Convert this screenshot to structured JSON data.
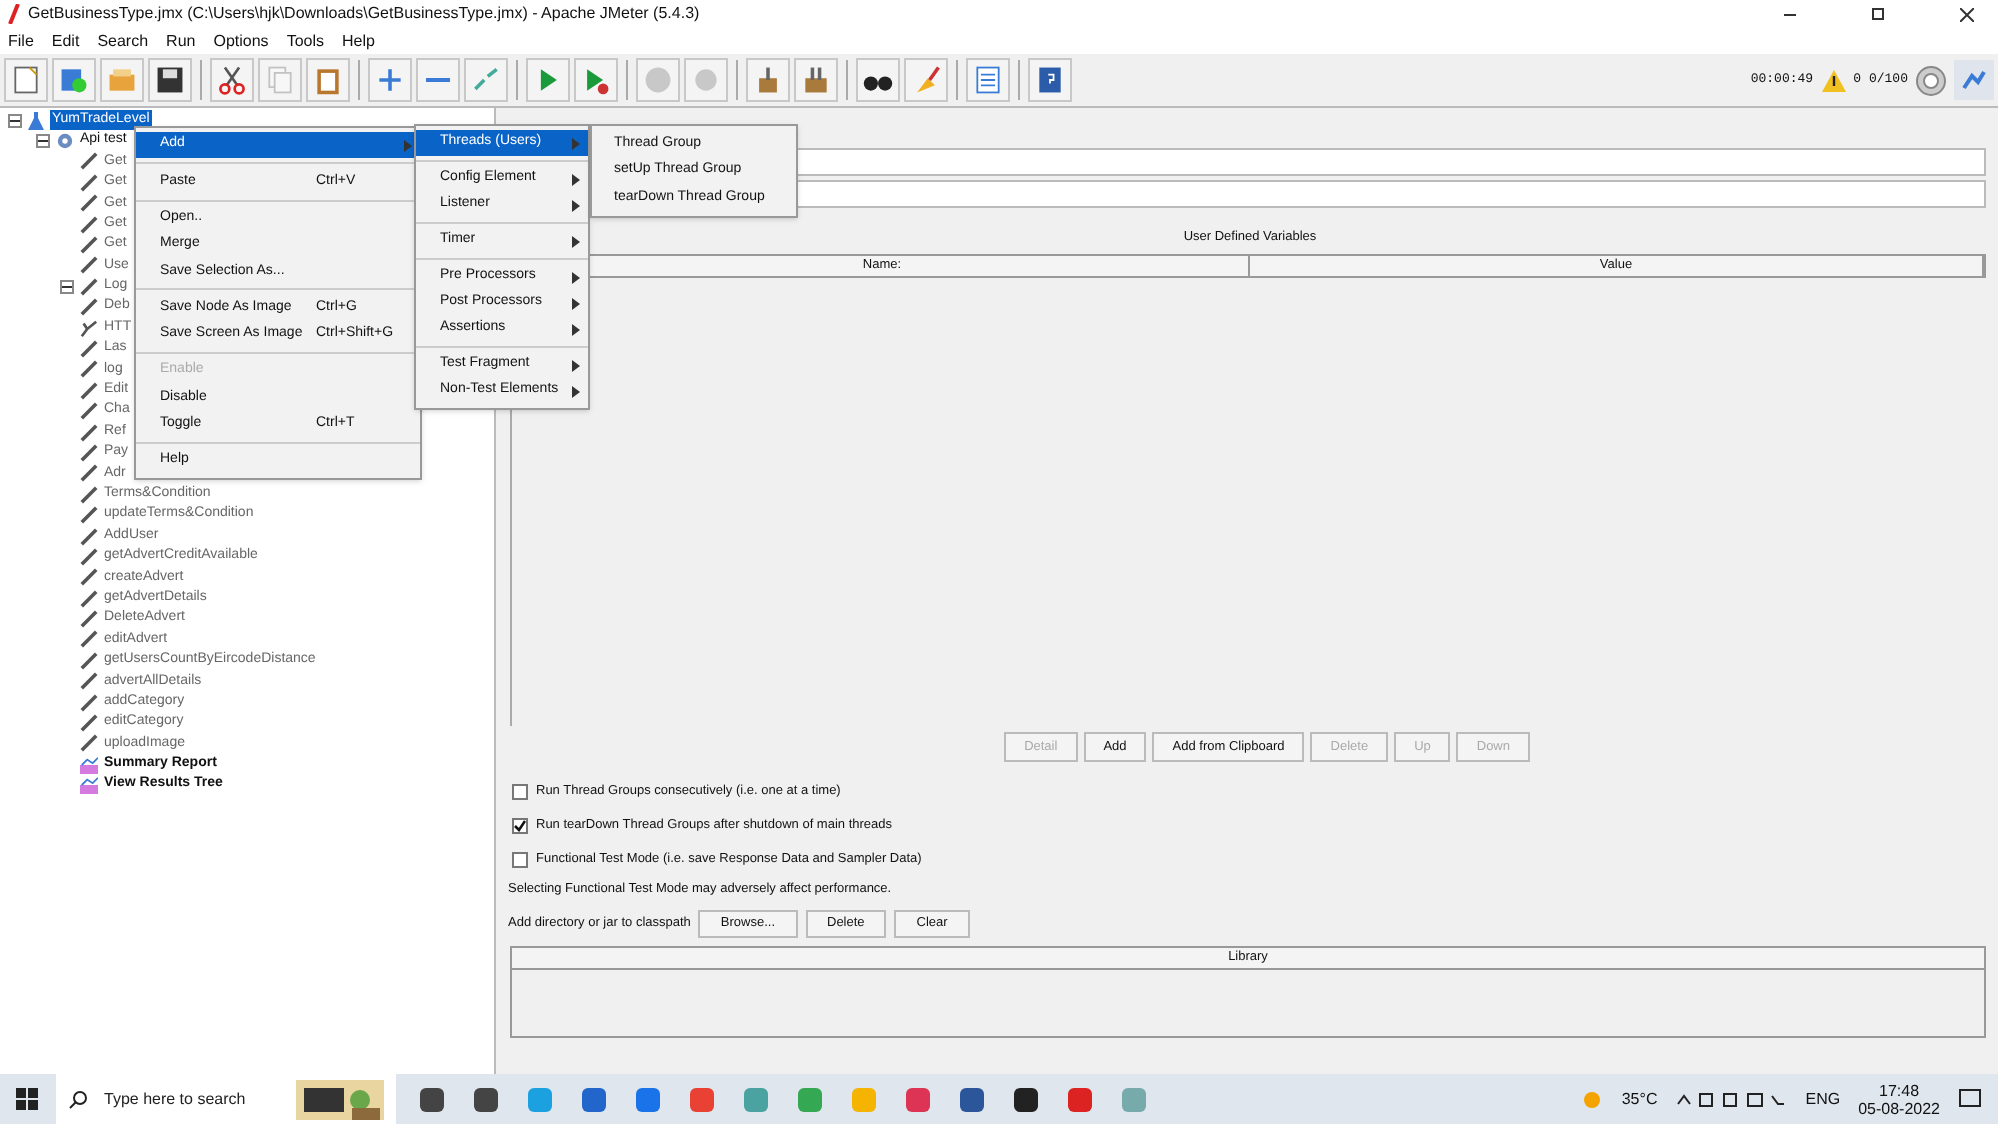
{
  "window": {
    "title": "GetBusinessType.jmx (C:\\Users\\hjk\\Downloads\\GetBusinessType.jmx) - Apache JMeter (5.4.3)"
  },
  "menu_bar": [
    "File",
    "Edit",
    "Search",
    "Run",
    "Options",
    "Tools",
    "Help"
  ],
  "toolbar": [
    {
      "kind": "new",
      "disabled": false
    },
    {
      "kind": "templates",
      "disabled": false
    },
    {
      "kind": "open",
      "disabled": false
    },
    {
      "kind": "save",
      "disabled": false
    },
    {
      "kind": "cut",
      "disabled": false
    },
    {
      "kind": "copy",
      "disabled": true
    },
    {
      "kind": "paste",
      "disabled": false
    },
    {
      "kind": "expand",
      "disabled": false
    },
    {
      "kind": "collapse",
      "disabled": false
    },
    {
      "kind": "toggle",
      "disabled": false
    },
    {
      "kind": "start",
      "disabled": false
    },
    {
      "kind": "start_no_pause",
      "disabled": false
    },
    {
      "kind": "stop",
      "disabled": true
    },
    {
      "kind": "shutdown",
      "disabled": true
    },
    {
      "kind": "clear",
      "disabled": false
    },
    {
      "kind": "clear_all",
      "disabled": false
    },
    {
      "kind": "search",
      "disabled": false
    },
    {
      "kind": "reset_search",
      "disabled": false
    },
    {
      "kind": "functions",
      "disabled": false
    },
    {
      "kind": "help",
      "disabled": false
    }
  ],
  "status": {
    "elapsed": "00:00:49",
    "warnings": "0",
    "threads": "0/100"
  },
  "tree": {
    "label": "YumTradeLevel",
    "selected": true,
    "expanded": true,
    "children": [
      {
        "label": "Api test",
        "kind": "thread_group",
        "expanded": true,
        "children": [
          {
            "label": "Get",
            "kind": "sampler"
          },
          {
            "label": "Get",
            "kind": "sampler"
          },
          {
            "label": "Get",
            "kind": "sampler"
          },
          {
            "label": "Get",
            "kind": "sampler"
          },
          {
            "label": "Get",
            "kind": "sampler"
          },
          {
            "label": "Use",
            "kind": "sampler"
          },
          {
            "label": "Log",
            "kind": "controller"
          },
          {
            "label": "Deb",
            "kind": "sampler"
          },
          {
            "label": "HTT",
            "kind": "broken"
          },
          {
            "label": "Las",
            "kind": "sampler"
          },
          {
            "label": "log",
            "kind": "sampler"
          },
          {
            "label": "Edit",
            "kind": "sampler"
          },
          {
            "label": "Cha",
            "kind": "sampler"
          },
          {
            "label": "Ref",
            "kind": "sampler"
          },
          {
            "label": "Pay",
            "kind": "sampler"
          },
          {
            "label": "Adr",
            "kind": "sampler"
          },
          {
            "label": "Terms&Condition",
            "kind": "sampler"
          },
          {
            "label": "updateTerms&Condition",
            "kind": "sampler"
          },
          {
            "label": "AddUser",
            "kind": "sampler"
          },
          {
            "label": "getAdvertCreditAvailable",
            "kind": "sampler"
          },
          {
            "label": "createAdvert",
            "kind": "sampler"
          },
          {
            "label": "getAdvertDetails",
            "kind": "sampler"
          },
          {
            "label": "DeleteAdvert",
            "kind": "sampler"
          },
          {
            "label": "editAdvert",
            "kind": "sampler"
          },
          {
            "label": "getUsersCountByEircodeDistance",
            "kind": "sampler"
          },
          {
            "label": "advertAllDetails",
            "kind": "sampler"
          },
          {
            "label": "addCategory",
            "kind": "sampler"
          },
          {
            "label": "editCategory",
            "kind": "sampler"
          },
          {
            "label": "uploadImage",
            "kind": "sampler"
          },
          {
            "label": "Summary Report",
            "kind": "listener"
          },
          {
            "label": "View Results Tree",
            "kind": "listener"
          }
        ]
      }
    ]
  },
  "context_menu": [
    [
      {
        "label": "Add",
        "submenu": true,
        "selected": true
      }
    ],
    [
      {
        "label": "Paste",
        "shortcut": "Ctrl+V"
      }
    ],
    [
      {
        "label": "Open.."
      },
      {
        "label": "Merge"
      },
      {
        "label": "Save Selection As..."
      }
    ],
    [
      {
        "label": "Save Node As Image",
        "shortcut": "Ctrl+G"
      },
      {
        "label": "Save Screen As Image",
        "shortcut": "Ctrl+Shift+G"
      }
    ],
    [
      {
        "label": "Enable",
        "disabled": true
      },
      {
        "label": "Disable"
      },
      {
        "label": "Toggle",
        "shortcut": "Ctrl+T"
      }
    ],
    [
      {
        "label": "Help"
      }
    ]
  ],
  "add_menu": [
    [
      {
        "label": "Threads (Users)",
        "selected": true
      }
    ],
    [
      {
        "label": "Config Element",
        "selected": false
      },
      {
        "label": "Listener",
        "selected": false
      }
    ],
    [
      {
        "label": "Timer",
        "selected": false
      }
    ],
    [
      {
        "label": "Pre Processors",
        "selected": false
      },
      {
        "label": "Post Processors",
        "selected": false
      },
      {
        "label": "Assertions",
        "selected": false
      }
    ],
    [
      {
        "label": "Test Fragment",
        "selected": false
      },
      {
        "label": "Non-Test Elements",
        "selected": false
      }
    ]
  ],
  "threads_menu": [
    "Thread Group",
    "setUp Thread Group",
    "tearDown Thread Group"
  ],
  "variables": {
    "title": "User Defined Variables",
    "columns": [
      "Name:",
      "Value"
    ]
  },
  "variable_buttons": [
    {
      "label": "Detail",
      "disabled": true
    },
    {
      "label": "Add",
      "disabled": false
    },
    {
      "label": "Add from Clipboard",
      "disabled": false
    },
    {
      "label": "Delete",
      "disabled": true
    },
    {
      "label": "Up",
      "disabled": true
    },
    {
      "label": "Down",
      "disabled": true
    }
  ],
  "options": [
    {
      "label": "Run Thread Groups consecutively (i.e. one at a time)",
      "checked": false
    },
    {
      "label": "Run tearDown Thread Groups after shutdown of main threads",
      "checked": true
    },
    {
      "label": "Functional Test Mode (i.e. save Response Data and Sampler Data)",
      "checked": false
    }
  ],
  "functional_note": "Selecting Functional Test Mode may adversely affect performance.",
  "classpath": {
    "label": "Add directory or jar to classpath",
    "buttons": [
      "Browse...",
      "Delete",
      "Clear"
    ],
    "column": "Library"
  },
  "taskbar": {
    "search_placeholder": "Type here to search",
    "weather": "35°C",
    "language": "ENG",
    "time": "17:48",
    "date": "05-08-2022"
  }
}
